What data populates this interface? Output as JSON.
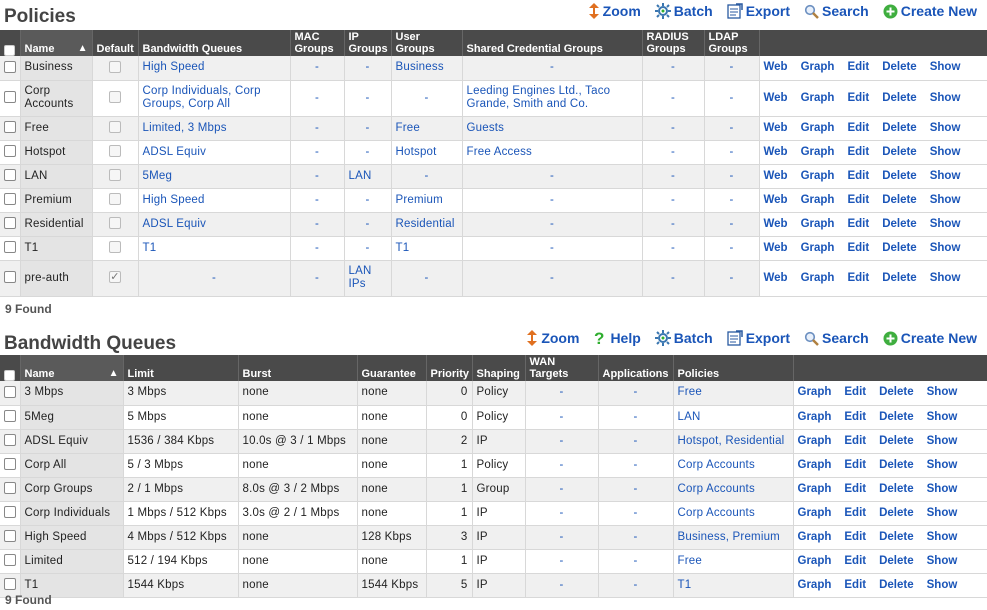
{
  "policies": {
    "title": "Policies",
    "actions": [
      {
        "label": "Zoom",
        "icon": "zoom-icon"
      },
      {
        "label": "Batch",
        "icon": "batch-icon"
      },
      {
        "label": "Export",
        "icon": "export-icon"
      },
      {
        "label": "Search",
        "icon": "search-icon"
      },
      {
        "label": "Create New",
        "icon": "create-new-icon"
      }
    ],
    "columns": [
      "Name",
      "Default",
      "Bandwidth Queues",
      "MAC Groups",
      "IP Groups",
      "User Groups",
      "Shared Credential Groups",
      "RADIUS Groups",
      "LDAP Groups"
    ],
    "row_actions": [
      "Web",
      "Graph",
      "Edit",
      "Delete",
      "Show"
    ],
    "rows": [
      {
        "name": "Business",
        "default": false,
        "bandwidth": "High Speed",
        "mac": "-",
        "ip": "-",
        "user": "Business",
        "shared": "-",
        "radius": "-",
        "ldap": "-"
      },
      {
        "name": "Corp Accounts",
        "default": false,
        "bandwidth": "Corp Individuals, Corp Groups, Corp All",
        "mac": "-",
        "ip": "-",
        "user": "-",
        "shared": "Leeding Engines Ltd., Taco Grande, Smith and Co.",
        "radius": "-",
        "ldap": "-"
      },
      {
        "name": "Free",
        "default": false,
        "bandwidth": "Limited, 3 Mbps",
        "mac": "-",
        "ip": "-",
        "user": "Free",
        "shared": "Guests",
        "radius": "-",
        "ldap": "-"
      },
      {
        "name": "Hotspot",
        "default": false,
        "bandwidth": "ADSL Equiv",
        "mac": "-",
        "ip": "-",
        "user": "Hotspot",
        "shared": "Free Access",
        "radius": "-",
        "ldap": "-"
      },
      {
        "name": "LAN",
        "default": false,
        "bandwidth": "5Meg",
        "mac": "-",
        "ip": "LAN",
        "user": "-",
        "shared": "-",
        "radius": "-",
        "ldap": "-"
      },
      {
        "name": "Premium",
        "default": false,
        "bandwidth": "High Speed",
        "mac": "-",
        "ip": "-",
        "user": "Premium",
        "shared": "-",
        "radius": "-",
        "ldap": "-"
      },
      {
        "name": "Residential",
        "default": false,
        "bandwidth": "ADSL Equiv",
        "mac": "-",
        "ip": "-",
        "user": "Residential",
        "shared": "-",
        "radius": "-",
        "ldap": "-"
      },
      {
        "name": "T1",
        "default": false,
        "bandwidth": "T1",
        "mac": "-",
        "ip": "-",
        "user": "T1",
        "shared": "-",
        "radius": "-",
        "ldap": "-"
      },
      {
        "name": "pre-auth",
        "default": true,
        "bandwidth": "-",
        "mac": "-",
        "ip": "LAN IPs",
        "user": "-",
        "shared": "-",
        "radius": "-",
        "ldap": "-"
      }
    ],
    "found": "9 Found"
  },
  "queues": {
    "title": "Bandwidth Queues",
    "actions": [
      {
        "label": "Zoom",
        "icon": "zoom-icon"
      },
      {
        "label": "Help",
        "icon": "help-icon"
      },
      {
        "label": "Batch",
        "icon": "batch-icon"
      },
      {
        "label": "Export",
        "icon": "export-icon"
      },
      {
        "label": "Search",
        "icon": "search-icon"
      },
      {
        "label": "Create New",
        "icon": "create-new-icon"
      }
    ],
    "columns": [
      "Name",
      "Limit",
      "Burst",
      "Guarantee",
      "Priority",
      "Shaping",
      "WAN Targets",
      "Applications",
      "Policies"
    ],
    "row_actions": [
      "Graph",
      "Edit",
      "Delete",
      "Show"
    ],
    "rows": [
      {
        "name": "3 Mbps",
        "limit": "3 Mbps",
        "burst": "none",
        "guarantee": "none",
        "priority": "0",
        "shaping": "Policy",
        "wan": "-",
        "apps": "-",
        "policies": "Free"
      },
      {
        "name": "5Meg",
        "limit": "5 Mbps",
        "burst": "none",
        "guarantee": "none",
        "priority": "0",
        "shaping": "Policy",
        "wan": "-",
        "apps": "-",
        "policies": "LAN"
      },
      {
        "name": "ADSL Equiv",
        "limit": "1536 / 384 Kbps",
        "burst": "10.0s @ 3 / 1 Mbps",
        "guarantee": "none",
        "priority": "2",
        "shaping": "IP",
        "wan": "-",
        "apps": "-",
        "policies": "Hotspot, Residential"
      },
      {
        "name": "Corp All",
        "limit": "5 / 3 Mbps",
        "burst": "none",
        "guarantee": "none",
        "priority": "1",
        "shaping": "Policy",
        "wan": "-",
        "apps": "-",
        "policies": "Corp Accounts"
      },
      {
        "name": "Corp Groups",
        "limit": "2 / 1 Mbps",
        "burst": "8.0s @ 3 / 2 Mbps",
        "guarantee": "none",
        "priority": "1",
        "shaping": "Group",
        "wan": "-",
        "apps": "-",
        "policies": "Corp Accounts"
      },
      {
        "name": "Corp Individuals",
        "limit": "1 Mbps / 512 Kbps",
        "burst": "3.0s @ 2 / 1 Mbps",
        "guarantee": "none",
        "priority": "1",
        "shaping": "IP",
        "wan": "-",
        "apps": "-",
        "policies": "Corp Accounts"
      },
      {
        "name": "High Speed",
        "limit": "4 Mbps / 512 Kbps",
        "burst": "none",
        "guarantee": "128 Kbps",
        "priority": "3",
        "shaping": "IP",
        "wan": "-",
        "apps": "-",
        "policies": "Business, Premium"
      },
      {
        "name": "Limited",
        "limit": "512 / 194 Kbps",
        "burst": "none",
        "guarantee": "none",
        "priority": "1",
        "shaping": "IP",
        "wan": "-",
        "apps": "-",
        "policies": "Free"
      },
      {
        "name": "T1",
        "limit": "1544 Kbps",
        "burst": "none",
        "guarantee": "1544 Kbps",
        "priority": "5",
        "shaping": "IP",
        "wan": "-",
        "apps": "-",
        "policies": "T1"
      }
    ],
    "found": "9 Found"
  }
}
